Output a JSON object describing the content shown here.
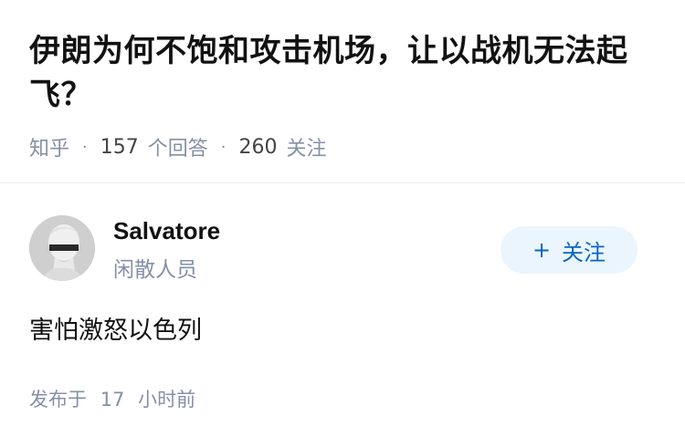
{
  "question": {
    "title": "伊朗为何不饱和攻击机场，让以战机无法起飞？",
    "source": "知乎",
    "answer_count": "157",
    "answer_label": "个回答",
    "follower_count": "260",
    "follower_label": "关注"
  },
  "author": {
    "name": "Salvatore",
    "bio": "闲散人员",
    "avatar_icon": "bust-statue-avatar",
    "follow_plus": "+",
    "follow_label": "关注"
  },
  "answer": {
    "content": "害怕激怒以色列",
    "published_prefix": "发布于",
    "published_num": "17",
    "published_suffix": "小时前"
  },
  "colors": {
    "text": "#121212",
    "meta": "#8590a6",
    "accent": "#0a66c2",
    "follow_bg": "#ebf5fd"
  }
}
